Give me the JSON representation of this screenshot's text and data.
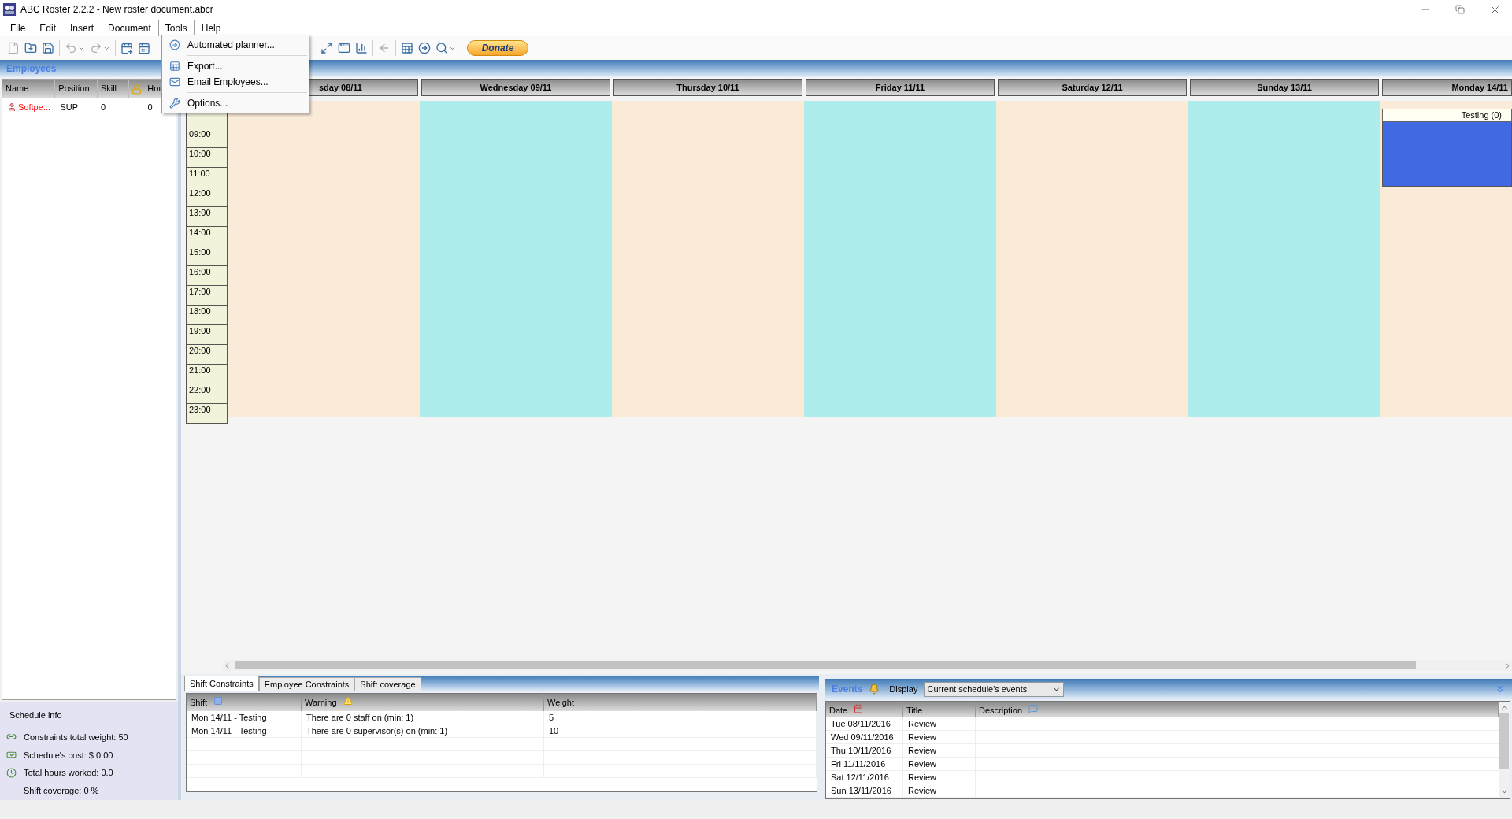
{
  "window": {
    "title": "ABC Roster 2.2.2 - New roster document.abcr"
  },
  "menu": [
    {
      "label": "File",
      "selected": false
    },
    {
      "label": "Edit",
      "selected": false
    },
    {
      "label": "Insert",
      "selected": false
    },
    {
      "label": "Document",
      "selected": false
    },
    {
      "label": "Tools",
      "selected": true
    },
    {
      "label": "Help",
      "selected": false
    }
  ],
  "tools_menu": [
    {
      "kind": "planner",
      "label": "Automated planner..."
    },
    {
      "kind": "separator"
    },
    {
      "kind": "export",
      "label": "Export..."
    },
    {
      "kind": "email",
      "label": "Email Employees..."
    },
    {
      "kind": "separator"
    },
    {
      "kind": "options",
      "label": "Options..."
    }
  ],
  "toolbar": {
    "donate_button": "Donate"
  },
  "employees_panel": {
    "title": "Employees",
    "columns": [
      {
        "kind": "text",
        "label": "Name"
      },
      {
        "kind": "text",
        "label": "Position"
      },
      {
        "kind": "text",
        "label": "Skill"
      },
      {
        "kind": "lock"
      },
      {
        "kind": "text",
        "label": "Hou"
      }
    ],
    "rows": [
      {
        "name": "Softpe...",
        "position": "SUP",
        "skill": "0",
        "hours": "0"
      }
    ]
  },
  "schedule_info": {
    "title": "Schedule info",
    "items": [
      {
        "kind": "chain",
        "text": "Constraints total weight: 50"
      },
      {
        "kind": "money",
        "text": "Schedule's cost: $ 0.00"
      },
      {
        "kind": "clock",
        "text": "Total hours worked: 0.0"
      },
      {
        "kind": "plain",
        "text": "Shift coverage: 0 %"
      }
    ]
  },
  "calendar": {
    "days": [
      {
        "label": "sday 08/11",
        "color": "#faead8"
      },
      {
        "label": "Wednesday 09/11",
        "color": "#afecec"
      },
      {
        "label": "Thursday 10/11",
        "color": "#faead8"
      },
      {
        "label": "Friday 11/11",
        "color": "#afecec"
      },
      {
        "label": "Saturday 12/11",
        "color": "#faead8"
      },
      {
        "label": "Sunday 13/11",
        "color": "#afecec"
      },
      {
        "label": "Monday 14/11",
        "color": "#faead8",
        "shift": "Testing (0)"
      }
    ],
    "times": [
      "09:00",
      "10:00",
      "11:00",
      "12:00",
      "13:00",
      "14:00",
      "15:00",
      "16:00",
      "17:00",
      "18:00",
      "19:00",
      "20:00",
      "21:00",
      "22:00",
      "23:00"
    ]
  },
  "constraints_panel": {
    "tabs": [
      {
        "label": "Shift Constraints",
        "selected": true
      },
      {
        "label": "Employee Constraints",
        "selected": false
      },
      {
        "label": "Shift coverage",
        "selected": false
      }
    ],
    "columns": [
      {
        "label": "Shift",
        "kind": "square"
      },
      {
        "label": "Warning",
        "kind": "warning"
      },
      {
        "label": "Weight",
        "kind": "plain"
      }
    ],
    "rows": [
      [
        "Mon 14/11 - Testing",
        "There are 0 staff on (min: 1)",
        "5"
      ],
      [
        "Mon 14/11 - Testing",
        "There are 0 supervisor(s) on (min: 1)",
        "10"
      ]
    ]
  },
  "events_panel": {
    "title": "Events",
    "display_label": "Display",
    "display_value": "Current schedule's events",
    "columns": [
      {
        "label": "Date",
        "kind": "calendar"
      },
      {
        "label": "Title",
        "kind": "plain"
      },
      {
        "label": "Description",
        "kind": "comment"
      }
    ],
    "rows": [
      [
        "Tue 08/11/2016",
        "Review"
      ],
      [
        "Wed 09/11/2016",
        "Review"
      ],
      [
        "Thu 10/11/2016",
        "Review"
      ],
      [
        "Fri 11/11/2016",
        "Review"
      ],
      [
        "Sat 12/11/2016",
        "Review"
      ],
      [
        "Sun 13/11/2016",
        "Review"
      ]
    ]
  }
}
